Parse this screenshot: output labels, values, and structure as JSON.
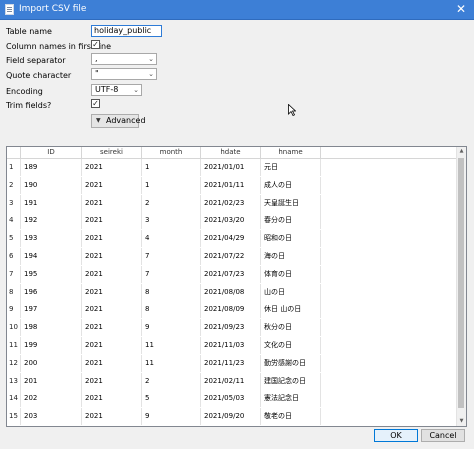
{
  "window": {
    "title": "Import CSV file",
    "close_glyph": "✕"
  },
  "form": {
    "table_name_label": "Table name",
    "table_name_value": "holiday_public",
    "column_names_label": "Column names in first line",
    "column_names_checked": true,
    "field_separator_label": "Field separator",
    "field_separator_value": ",",
    "quote_char_label": "Quote character",
    "quote_char_value": "\"",
    "encoding_label": "Encoding",
    "encoding_value": "UTF-8",
    "trim_fields_label": "Trim fields?",
    "trim_fields_checked": true,
    "advanced_label": "Advanced",
    "check_glyph": "✓",
    "combo_arrow": "⌄",
    "advanced_arrow": "▼"
  },
  "grid": {
    "columns": [
      "ID",
      "seireki",
      "month",
      "hdate",
      "hname"
    ],
    "rows": [
      {
        "n": "1",
        "id": "189",
        "seireki": "2021",
        "month": "1",
        "hdate": "2021/01/01",
        "hname": "元日"
      },
      {
        "n": "2",
        "id": "190",
        "seireki": "2021",
        "month": "1",
        "hdate": "2021/01/11",
        "hname": "成人の日"
      },
      {
        "n": "3",
        "id": "191",
        "seireki": "2021",
        "month": "2",
        "hdate": "2021/02/23",
        "hname": "天皇誕生日"
      },
      {
        "n": "4",
        "id": "192",
        "seireki": "2021",
        "month": "3",
        "hdate": "2021/03/20",
        "hname": "春分の日"
      },
      {
        "n": "5",
        "id": "193",
        "seireki": "2021",
        "month": "4",
        "hdate": "2021/04/29",
        "hname": "昭和の日"
      },
      {
        "n": "6",
        "id": "194",
        "seireki": "2021",
        "month": "7",
        "hdate": "2021/07/22",
        "hname": "海の日"
      },
      {
        "n": "7",
        "id": "195",
        "seireki": "2021",
        "month": "7",
        "hdate": "2021/07/23",
        "hname": "体育の日"
      },
      {
        "n": "8",
        "id": "196",
        "seireki": "2021",
        "month": "8",
        "hdate": "2021/08/08",
        "hname": "山の日"
      },
      {
        "n": "9",
        "id": "197",
        "seireki": "2021",
        "month": "8",
        "hdate": "2021/08/09",
        "hname": "休日 山の日"
      },
      {
        "n": "10",
        "id": "198",
        "seireki": "2021",
        "month": "9",
        "hdate": "2021/09/23",
        "hname": "秋分の日"
      },
      {
        "n": "11",
        "id": "199",
        "seireki": "2021",
        "month": "11",
        "hdate": "2021/11/03",
        "hname": "文化の日"
      },
      {
        "n": "12",
        "id": "200",
        "seireki": "2021",
        "month": "11",
        "hdate": "2021/11/23",
        "hname": "勤労感謝の日"
      },
      {
        "n": "13",
        "id": "201",
        "seireki": "2021",
        "month": "2",
        "hdate": "2021/02/11",
        "hname": "建国記念の日"
      },
      {
        "n": "14",
        "id": "202",
        "seireki": "2021",
        "month": "5",
        "hdate": "2021/05/03",
        "hname": "憲法記念日"
      },
      {
        "n": "15",
        "id": "203",
        "seireki": "2021",
        "month": "9",
        "hdate": "2021/09/20",
        "hname": "敬老の日"
      }
    ]
  },
  "buttons": {
    "ok_label": "OK",
    "cancel_label": "Cancel"
  },
  "colors": {
    "titlebar": "#3d7fd6",
    "focus_border": "#2e7bd6",
    "ok_border": "#0078d7"
  }
}
